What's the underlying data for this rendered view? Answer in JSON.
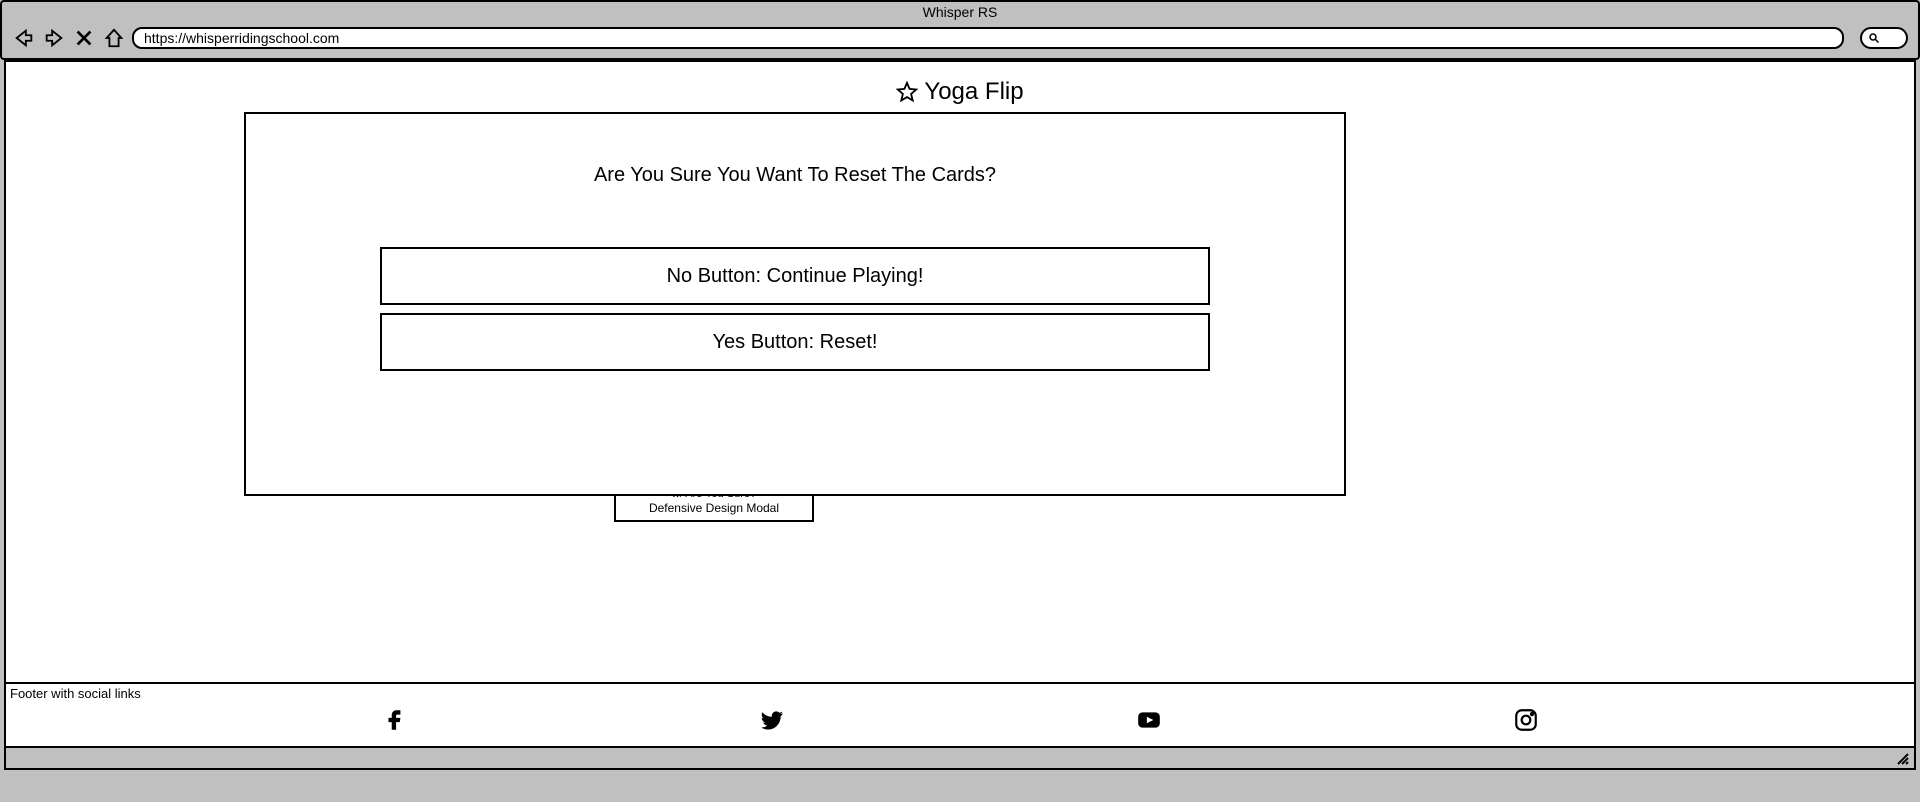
{
  "browser": {
    "title": "Whisper RS",
    "url": "https://whisperridingschool.com"
  },
  "page": {
    "title": "Yoga Flip"
  },
  "modal": {
    "question": "Are You Sure You Want To Reset The Cards?",
    "no_button_label": "No Button: Continue Playing!",
    "yes_button_label": "Yes Button: Reset!"
  },
  "behind": {
    "line1": "w/ Are You Sure?",
    "line2": "Defensive Design Modal"
  },
  "footer": {
    "label": "Footer with social links"
  }
}
